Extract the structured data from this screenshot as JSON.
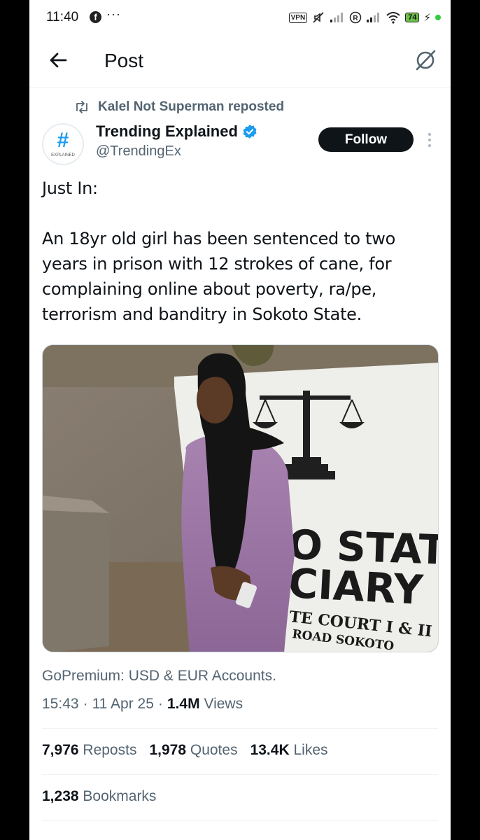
{
  "status_bar": {
    "time": "11:40",
    "notification_icon": "facebook-icon",
    "more_indicator": "···",
    "vpn_label": "VPN",
    "battery_level": "74",
    "battery_color": "#6ec24b"
  },
  "header": {
    "title": "Post",
    "back_icon": "arrow-left-icon",
    "grok_icon": "grok-icon"
  },
  "repost": {
    "text": "Kalel Not Superman reposted",
    "icon": "repost-icon"
  },
  "author": {
    "name": "Trending Explained",
    "handle": "@TrendingEx",
    "verified_color": "#1d9bf0",
    "avatar_icon": "hashtag-logo",
    "avatar_caption": "EXPLAINED"
  },
  "follow_label": "Follow",
  "post": {
    "paragraphs": [
      "Just In:",
      "An 18yr old girl has been sentenced to two years in prison with 12 strokes of cane, for complaining online about poverty, ra/pe, terrorism and banditry in Sokoto State."
    ]
  },
  "media": {
    "sign_line1": "O STATE",
    "sign_line2": "CIARY",
    "sign_line3": "TE COURT  I & II",
    "sign_line4": "ROAD SOKOTO"
  },
  "promo_text": "GoPremium: USD & EUR Accounts.",
  "meta": {
    "time": "15:43",
    "separator": "·",
    "date": "11 Apr 25",
    "views_count": "1.4M",
    "views_label": "Views"
  },
  "stats": {
    "reposts_count": "7,976",
    "reposts_label": "Reposts",
    "quotes_count": "1,978",
    "quotes_label": "Quotes",
    "likes_count": "13.4K",
    "likes_label": "Likes",
    "bookmarks_count": "1,238",
    "bookmarks_label": "Bookmarks"
  },
  "colors": {
    "text_primary": "#0f1419",
    "text_secondary": "#536471",
    "accent": "#1d9bf0",
    "divider": "#eff3f4"
  }
}
